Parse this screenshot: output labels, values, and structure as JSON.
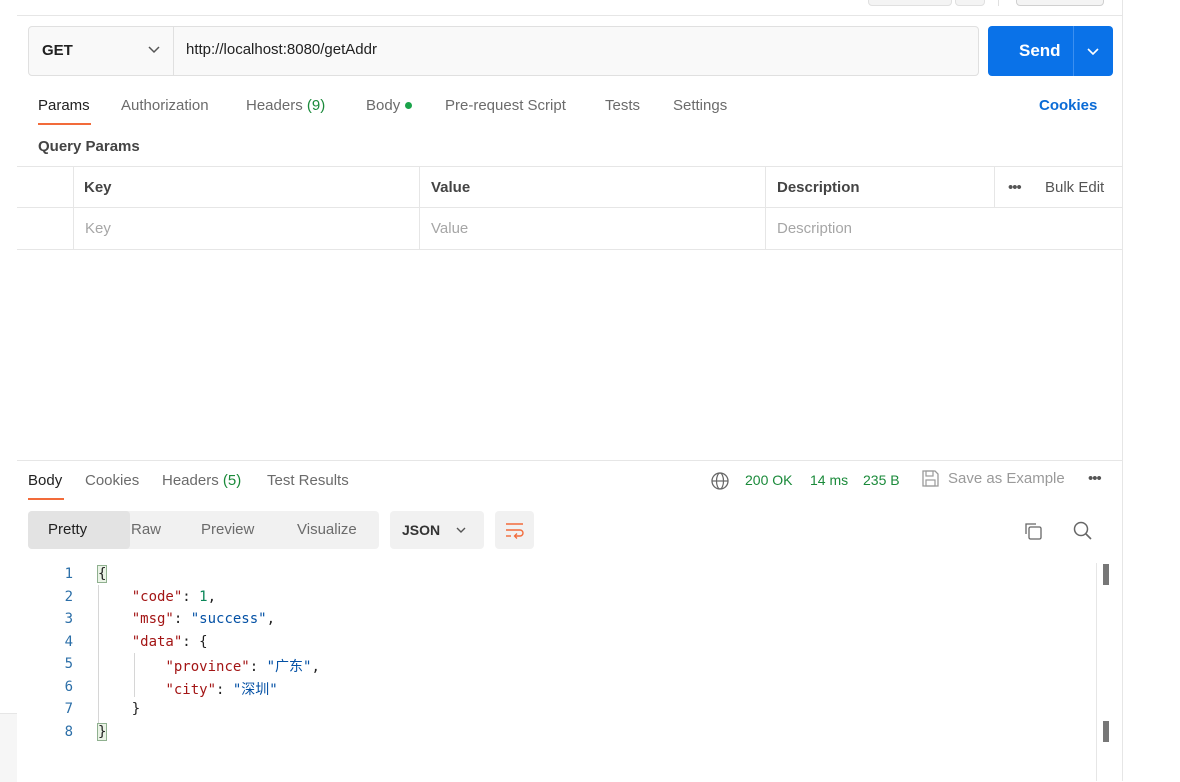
{
  "request": {
    "method": "GET",
    "url": "http://localhost:8080/getAddr",
    "send_label": "Send"
  },
  "request_tabs": {
    "params": "Params",
    "authorization": "Authorization",
    "headers": "Headers",
    "headers_count": "(9)",
    "body": "Body",
    "pre_request": "Pre-request Script",
    "tests": "Tests",
    "settings": "Settings",
    "cookies": "Cookies"
  },
  "query_params": {
    "title": "Query Params",
    "columns": [
      "Key",
      "Value",
      "Description"
    ],
    "bulk_edit": "Bulk Edit",
    "placeholders": [
      "Key",
      "Value",
      "Description"
    ]
  },
  "response": {
    "tabs": {
      "body": "Body",
      "cookies": "Cookies",
      "headers": "Headers",
      "headers_count": "(5)",
      "test_results": "Test Results"
    },
    "status": "200 OK",
    "time": "14 ms",
    "size": "235 B",
    "save_example": "Save as Example",
    "views": [
      "Pretty",
      "Raw",
      "Preview",
      "Visualize"
    ],
    "format": "JSON",
    "line_numbers": [
      "1",
      "2",
      "3",
      "4",
      "5",
      "6",
      "7",
      "8"
    ],
    "json": {
      "code_key": "\"code\"",
      "code_val": "1",
      "msg_key": "\"msg\"",
      "msg_val": "\"success\"",
      "data_key": "\"data\"",
      "province_key": "\"province\"",
      "province_val": "\"广东\"",
      "city_key": "\"city\"",
      "city_val": "\"深圳\""
    }
  },
  "colors": {
    "accent_tab": "#f26b3a",
    "send_button": "#0a72e8",
    "status_ok": "#1a8a3a"
  }
}
